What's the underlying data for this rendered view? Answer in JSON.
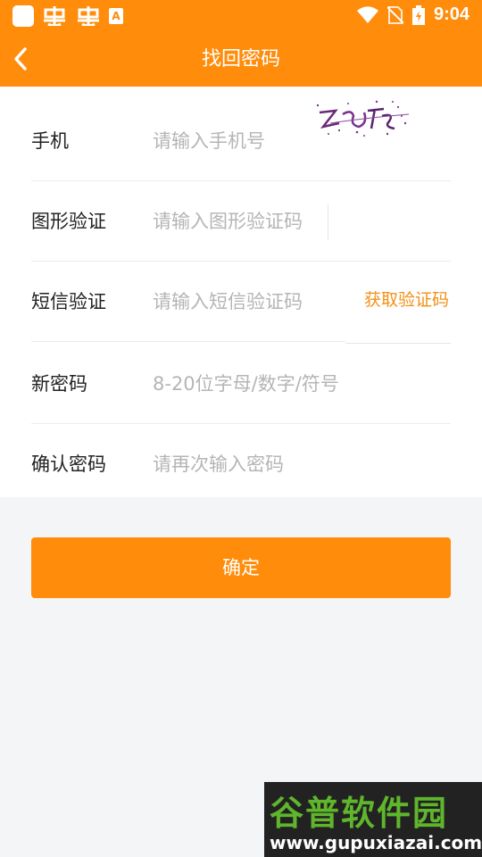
{
  "statusbar": {
    "time": "9:04",
    "app_badge": "A"
  },
  "header": {
    "title": "找回密码"
  },
  "form": {
    "phone": {
      "label": "手机",
      "placeholder": "请输入手机号"
    },
    "captcha": {
      "label": "图形验证",
      "placeholder": "请输入图形验证码"
    },
    "sms": {
      "label": "短信验证",
      "placeholder": "请输入短信验证码",
      "get_code": "获取验证码"
    },
    "new_password": {
      "label": "新密码",
      "placeholder": "8-20位字母/数字/符号"
    },
    "confirm_password": {
      "label": "确认密码",
      "placeholder": "请再次输入密码"
    }
  },
  "confirm_button": "确定",
  "watermark": {
    "name": "谷普软件园",
    "url": "www.gupuxiazai.com"
  },
  "colors": {
    "accent": "#ff8c0a",
    "link": "#f39016",
    "background": "#f4f5f7"
  }
}
